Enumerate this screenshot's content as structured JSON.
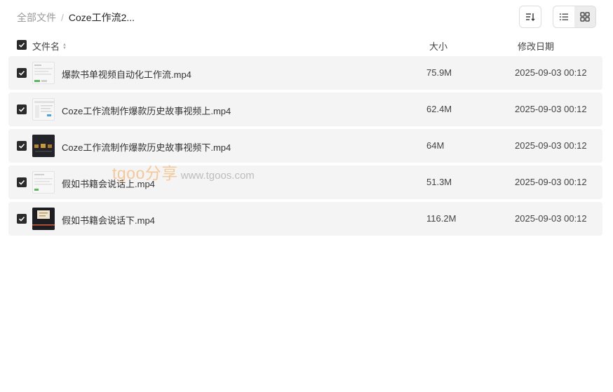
{
  "breadcrumb": {
    "root": "全部文件",
    "separator": "/",
    "current": "Coze工作流2..."
  },
  "toolbar": {
    "sort_icon": "sort-icon",
    "list_view_icon": "list-view-icon",
    "grid_view_icon": "grid-view-icon",
    "active_view": "list"
  },
  "table": {
    "headers": {
      "name": "文件名",
      "size": "大小",
      "date": "修改日期"
    },
    "rows": [
      {
        "name": "爆款书单视频自动化工作流.mp4",
        "size": "75.9M",
        "date": "2025-09-03 00:12",
        "thumb": "light"
      },
      {
        "name": "Coze工作流制作爆款历史故事视频上.mp4",
        "size": "62.4M",
        "date": "2025-09-03 00:12",
        "thumb": "light"
      },
      {
        "name": "Coze工作流制作爆款历史故事视频下.mp4",
        "size": "64M",
        "date": "2025-09-03 00:12",
        "thumb": "dark"
      },
      {
        "name": "假如书籍会说话上.mp4",
        "size": "51.3M",
        "date": "2025-09-03 00:12",
        "thumb": "light"
      },
      {
        "name": "假如书籍会说话下.mp4",
        "size": "116.2M",
        "date": "2025-09-03 00:12",
        "thumb": "dark"
      }
    ]
  },
  "watermark": {
    "brand": "tgoo分享",
    "url": "www.tgoos.com"
  },
  "colors": {
    "row_bg": "#f4f4f5",
    "checkbox": "#2b2b2b",
    "watermark": "#f4c99a"
  }
}
